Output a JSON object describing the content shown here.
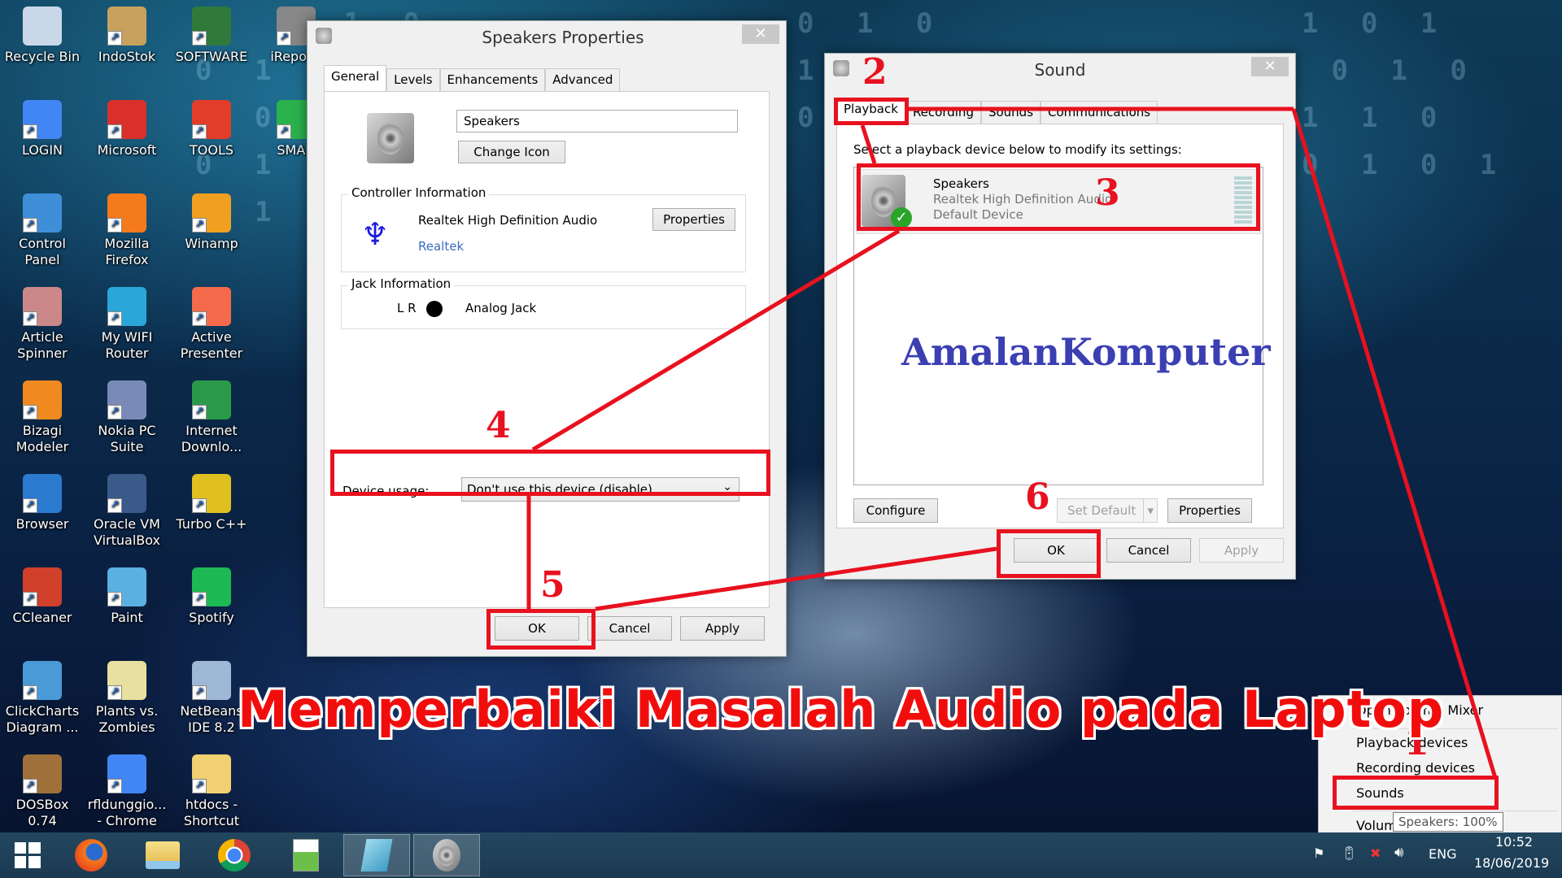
{
  "desktop": {
    "icons": [
      {
        "label": "Recycle Bin"
      },
      {
        "label": "IndoStok"
      },
      {
        "label": "SOFTWARE"
      },
      {
        "label": "iReport-"
      },
      {
        "label": "LOGIN"
      },
      {
        "label": "Microsoft"
      },
      {
        "label": "TOOLS"
      },
      {
        "label": "SMAD"
      },
      {
        "label": "Control Panel"
      },
      {
        "label": "Mozilla Firefox"
      },
      {
        "label": "Winamp"
      },
      {
        "label": "Article Spinner"
      },
      {
        "label": "My WIFI Router"
      },
      {
        "label": "Active Presenter"
      },
      {
        "label": "Bizagi Modeler"
      },
      {
        "label": "Nokia PC Suite"
      },
      {
        "label": "Internet Downlo..."
      },
      {
        "label": "Browser"
      },
      {
        "label": "Oracle VM VirtualBox"
      },
      {
        "label": "Turbo C++"
      },
      {
        "label": "CCleaner"
      },
      {
        "label": "Paint"
      },
      {
        "label": "Spotify"
      },
      {
        "label": "ClickCharts Diagram ..."
      },
      {
        "label": "Plants vs. Zombies"
      },
      {
        "label": "NetBeans IDE 8.2"
      },
      {
        "label": "DOSBox 0.74"
      },
      {
        "label": "rfldunggio... - Chrome"
      },
      {
        "label": "htdocs - Shortcut"
      }
    ]
  },
  "speakers_properties": {
    "title": "Speakers Properties",
    "close": "✕",
    "tabs": [
      "General",
      "Levels",
      "Enhancements",
      "Advanced"
    ],
    "active_tab": "General",
    "name_value": "Speakers",
    "change_icon_label": "Change Icon",
    "controller_legend": "Controller Information",
    "controller_name": "Realtek High Definition Audio",
    "controller_vendor": "Realtek",
    "controller_properties_label": "Properties",
    "jack_legend": "Jack Information",
    "jack_channels": "L R",
    "jack_type": "Analog Jack",
    "device_usage_label": "Device usage:",
    "device_usage_value": "Don't use this device (disable)",
    "ok_label": "OK",
    "cancel_label": "Cancel",
    "apply_label": "Apply"
  },
  "sound_dialog": {
    "title": "Sound",
    "close": "✕",
    "tabs": [
      "Playback",
      "Recording",
      "Sounds",
      "Communications"
    ],
    "active_tab": "Playback",
    "instruction": "Select a playback device below to modify its settings:",
    "devices": [
      {
        "name": "Speakers",
        "driver": "Realtek High Definition Audio",
        "status": "Default Device"
      }
    ],
    "watermark": "AmalanKomputer",
    "configure_label": "Configure",
    "set_default_label": "Set Default",
    "properties_label": "Properties",
    "ok_label": "OK",
    "cancel_label": "Cancel",
    "apply_label": "Apply"
  },
  "context_menu": {
    "items": [
      "Open Volume Mixer",
      "Playback devices",
      "Recording devices",
      "Sounds",
      "Volume control options"
    ],
    "tooltip": "Speakers: 100%"
  },
  "annotations": {
    "steps": [
      "1",
      "2",
      "3",
      "4",
      "5",
      "6"
    ],
    "color": "#e8111f",
    "banner": "Memperbaiki Masalah Audio pada Laptop"
  },
  "taskbar": {
    "apps": [
      "start",
      "firefox",
      "file-explorer",
      "chrome",
      "notepad-plus-plus",
      "notepad",
      "sound"
    ],
    "language": "ENG",
    "time": "10:52",
    "date": "18/06/2019"
  }
}
